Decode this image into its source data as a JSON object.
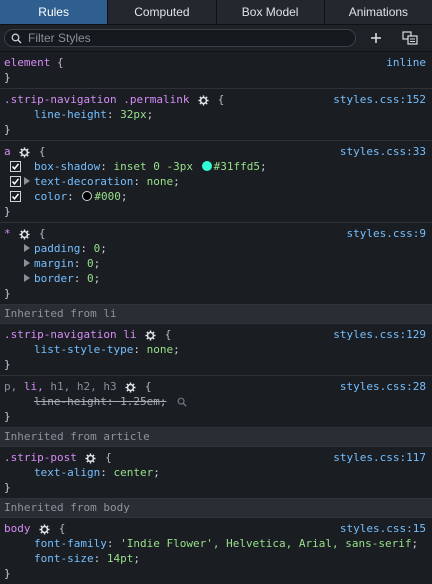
{
  "tabs": [
    "Rules",
    "Computed",
    "Box Model",
    "Animations"
  ],
  "filter": {
    "placeholder": "Filter Styles"
  },
  "colors": {
    "accent": "#31ffd5",
    "black": "#000000"
  },
  "rules": {
    "element": {
      "selector": "element",
      "brace_open": "{",
      "brace_close": "}",
      "source": "inline"
    },
    "r1": {
      "sel1": ".strip-navigation",
      "sel2": ".permalink",
      "source": "styles.css:152",
      "prop": "line-height",
      "val": "32px"
    },
    "r2": {
      "selector": "a",
      "source": "styles.css:33",
      "d1_prop": "box-shadow",
      "d1_val_a": "inset 0 -3px",
      "d1_val_b": "#31ffd5",
      "d2_prop": "text-decoration",
      "d2_val": "none",
      "d3_prop": "color",
      "d3_val": "#000"
    },
    "r3": {
      "selector": "*",
      "source": "styles.css:9",
      "d1_prop": "padding",
      "d1_val": "0",
      "d2_prop": "margin",
      "d2_val": "0",
      "d3_prop": "border",
      "d3_val": "0"
    },
    "h1": "Inherited from li",
    "r4": {
      "selector": ".strip-navigation li",
      "source": "styles.css:129",
      "prop": "list-style-type",
      "val": "none"
    },
    "r5": {
      "sel_p": "p,",
      "sel_li": "li,",
      "sel_rest": "h1, h2, h3",
      "source": "styles.css:28",
      "prop": "line-height",
      "val": "1.25em"
    },
    "h2": "Inherited from article",
    "r6": {
      "selector": ".strip-post",
      "source": "styles.css:117",
      "prop": "text-align",
      "val": "center"
    },
    "h3": "Inherited from body",
    "r7": {
      "selector": "body",
      "source": "styles.css:15",
      "d1_prop": "font-family",
      "d1_val": "'Indie Flower', Helvetica, Arial, sans-serif",
      "d2_prop": "font-size",
      "d2_val": "14pt"
    }
  }
}
